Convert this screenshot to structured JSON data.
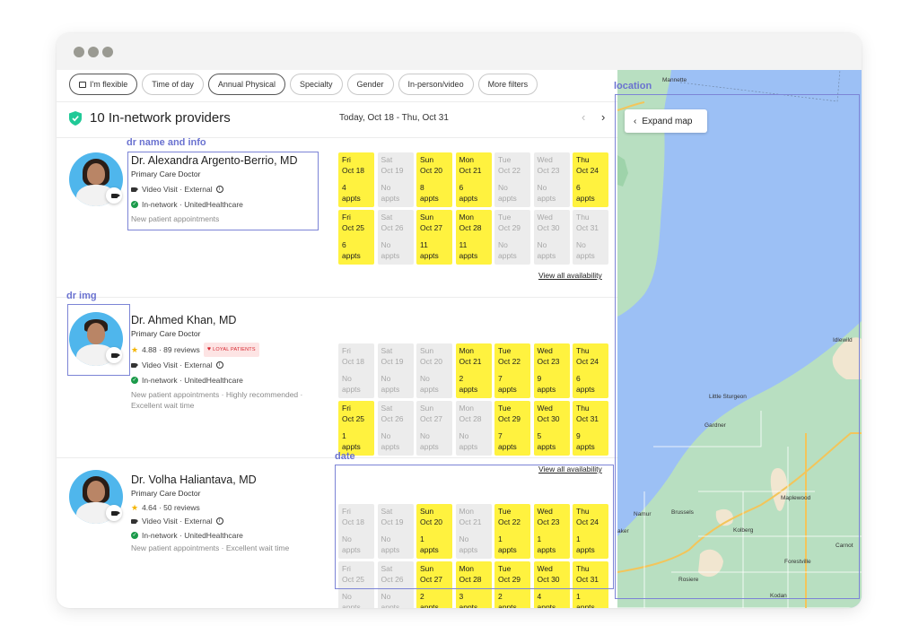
{
  "window": {
    "controls": [
      "close",
      "minimize",
      "maximize"
    ]
  },
  "filters": [
    {
      "label": "I'm flexible",
      "icon": "calendar-icon",
      "active": true
    },
    {
      "label": "Time of day",
      "active": false
    },
    {
      "label": "Annual Physical",
      "active": true
    },
    {
      "label": "Specialty",
      "active": false
    },
    {
      "label": "Gender",
      "active": false
    },
    {
      "label": "In-person/video",
      "active": false
    },
    {
      "label": "More filters",
      "active": false
    }
  ],
  "results": {
    "title": "10 In-network providers",
    "date_range": "Today, Oct 18 - Thu, Oct 31",
    "prev": "‹",
    "next": "›"
  },
  "annotations": {
    "name_info": "dr name and info",
    "img": "dr img",
    "date": "date",
    "location": "location"
  },
  "providers": [
    {
      "name": "Dr. Alexandra Argento-Berrio, MD",
      "specialty": "Primary Care Doctor",
      "video": "Video Visit · External",
      "network": "In-network · UnitedHealthcare",
      "notes": "New patient appointments",
      "view_all": "View all availability",
      "slots": [
        {
          "day": "Fri",
          "date": "Oct 18",
          "count": "4",
          "unit": "appts",
          "avail": true
        },
        {
          "day": "Sat",
          "date": "Oct 19",
          "count": "No",
          "unit": "appts",
          "avail": false
        },
        {
          "day": "Sun",
          "date": "Oct 20",
          "count": "8",
          "unit": "appts",
          "avail": true
        },
        {
          "day": "Mon",
          "date": "Oct 21",
          "count": "6",
          "unit": "appts",
          "avail": true
        },
        {
          "day": "Tue",
          "date": "Oct 22",
          "count": "No",
          "unit": "appts",
          "avail": false
        },
        {
          "day": "Wed",
          "date": "Oct 23",
          "count": "No",
          "unit": "appts",
          "avail": false
        },
        {
          "day": "Thu",
          "date": "Oct 24",
          "count": "6",
          "unit": "appts",
          "avail": true
        },
        {
          "day": "Fri",
          "date": "Oct 25",
          "count": "6",
          "unit": "appts",
          "avail": true
        },
        {
          "day": "Sat",
          "date": "Oct 26",
          "count": "No",
          "unit": "appts",
          "avail": false
        },
        {
          "day": "Sun",
          "date": "Oct 27",
          "count": "11",
          "unit": "appts",
          "avail": true
        },
        {
          "day": "Mon",
          "date": "Oct 28",
          "count": "11",
          "unit": "appts",
          "avail": true
        },
        {
          "day": "Tue",
          "date": "Oct 29",
          "count": "No",
          "unit": "appts",
          "avail": false
        },
        {
          "day": "Wed",
          "date": "Oct 30",
          "count": "No",
          "unit": "appts",
          "avail": false
        },
        {
          "day": "Thu",
          "date": "Oct 31",
          "count": "No",
          "unit": "appts",
          "avail": false
        }
      ]
    },
    {
      "name": "Dr. Ahmed Khan, MD",
      "specialty": "Primary Care Doctor",
      "rating": "4.88 · 89 reviews",
      "badge": "LOYAL PATIENTS",
      "video": "Video Visit · External",
      "network": "In-network · UnitedHealthcare",
      "notes": "New patient appointments · Highly recommended · Excellent wait time",
      "view_all": "View all availability",
      "slots": [
        {
          "day": "Fri",
          "date": "Oct 18",
          "count": "No",
          "unit": "appts",
          "avail": false
        },
        {
          "day": "Sat",
          "date": "Oct 19",
          "count": "No",
          "unit": "appts",
          "avail": false
        },
        {
          "day": "Sun",
          "date": "Oct 20",
          "count": "No",
          "unit": "appts",
          "avail": false
        },
        {
          "day": "Mon",
          "date": "Oct 21",
          "count": "2",
          "unit": "appts",
          "avail": true
        },
        {
          "day": "Tue",
          "date": "Oct 22",
          "count": "7",
          "unit": "appts",
          "avail": true
        },
        {
          "day": "Wed",
          "date": "Oct 23",
          "count": "9",
          "unit": "appts",
          "avail": true
        },
        {
          "day": "Thu",
          "date": "Oct 24",
          "count": "6",
          "unit": "appts",
          "avail": true
        },
        {
          "day": "Fri",
          "date": "Oct 25",
          "count": "1",
          "unit": "appts",
          "avail": true
        },
        {
          "day": "Sat",
          "date": "Oct 26",
          "count": "No",
          "unit": "appts",
          "avail": false
        },
        {
          "day": "Sun",
          "date": "Oct 27",
          "count": "No",
          "unit": "appts",
          "avail": false
        },
        {
          "day": "Mon",
          "date": "Oct 28",
          "count": "No",
          "unit": "appts",
          "avail": false
        },
        {
          "day": "Tue",
          "date": "Oct 29",
          "count": "7",
          "unit": "appts",
          "avail": true
        },
        {
          "day": "Wed",
          "date": "Oct 30",
          "count": "5",
          "unit": "appts",
          "avail": true
        },
        {
          "day": "Thu",
          "date": "Oct 31",
          "count": "9",
          "unit": "appts",
          "avail": true
        }
      ]
    },
    {
      "name": "Dr. Volha Haliantava, MD",
      "specialty": "Primary Care Doctor",
      "rating": "4.64 · 50 reviews",
      "video": "Video Visit · External",
      "network": "In-network · UnitedHealthcare",
      "notes": "New patient appointments · Excellent wait time",
      "view_all": "View all availability",
      "slots": [
        {
          "day": "Fri",
          "date": "Oct 18",
          "count": "No",
          "unit": "appts",
          "avail": false
        },
        {
          "day": "Sat",
          "date": "Oct 19",
          "count": "No",
          "unit": "appts",
          "avail": false
        },
        {
          "day": "Sun",
          "date": "Oct 20",
          "count": "1",
          "unit": "appts",
          "avail": true
        },
        {
          "day": "Mon",
          "date": "Oct 21",
          "count": "No",
          "unit": "appts",
          "avail": false
        },
        {
          "day": "Tue",
          "date": "Oct 22",
          "count": "1",
          "unit": "appts",
          "avail": true
        },
        {
          "day": "Wed",
          "date": "Oct 23",
          "count": "1",
          "unit": "appts",
          "avail": true
        },
        {
          "day": "Thu",
          "date": "Oct 24",
          "count": "1",
          "unit": "appts",
          "avail": true
        },
        {
          "day": "Fri",
          "date": "Oct 25",
          "count": "No",
          "unit": "appts",
          "avail": false
        },
        {
          "day": "Sat",
          "date": "Oct 26",
          "count": "No",
          "unit": "appts",
          "avail": false
        },
        {
          "day": "Sun",
          "date": "Oct 27",
          "count": "2",
          "unit": "appts",
          "avail": true
        },
        {
          "day": "Mon",
          "date": "Oct 28",
          "count": "3",
          "unit": "appts",
          "avail": true
        },
        {
          "day": "Tue",
          "date": "Oct 29",
          "count": "2",
          "unit": "appts",
          "avail": true
        },
        {
          "day": "Wed",
          "date": "Oct 30",
          "count": "4",
          "unit": "appts",
          "avail": true
        },
        {
          "day": "Thu",
          "date": "Oct 31",
          "count": "1",
          "unit": "appts",
          "avail": true
        }
      ]
    }
  ],
  "map": {
    "expand_label": "Expand map",
    "places": [
      "Mannette",
      "Idlewild",
      "Little Sturgeon",
      "Gardner",
      "Maplewood",
      "Namur",
      "Brussels",
      "aker",
      "Kolberg",
      "Carnot",
      "Forestville",
      "Rosiere",
      "Kodan"
    ]
  },
  "colors": {
    "available": "#fff23f",
    "unavailable": "#ececec",
    "annotation": "#6a72d0",
    "water": "#9cc0f5",
    "land": "#b8dfc1",
    "in_network": "#1b9a4a",
    "loyal_badge": "#d6262f"
  }
}
